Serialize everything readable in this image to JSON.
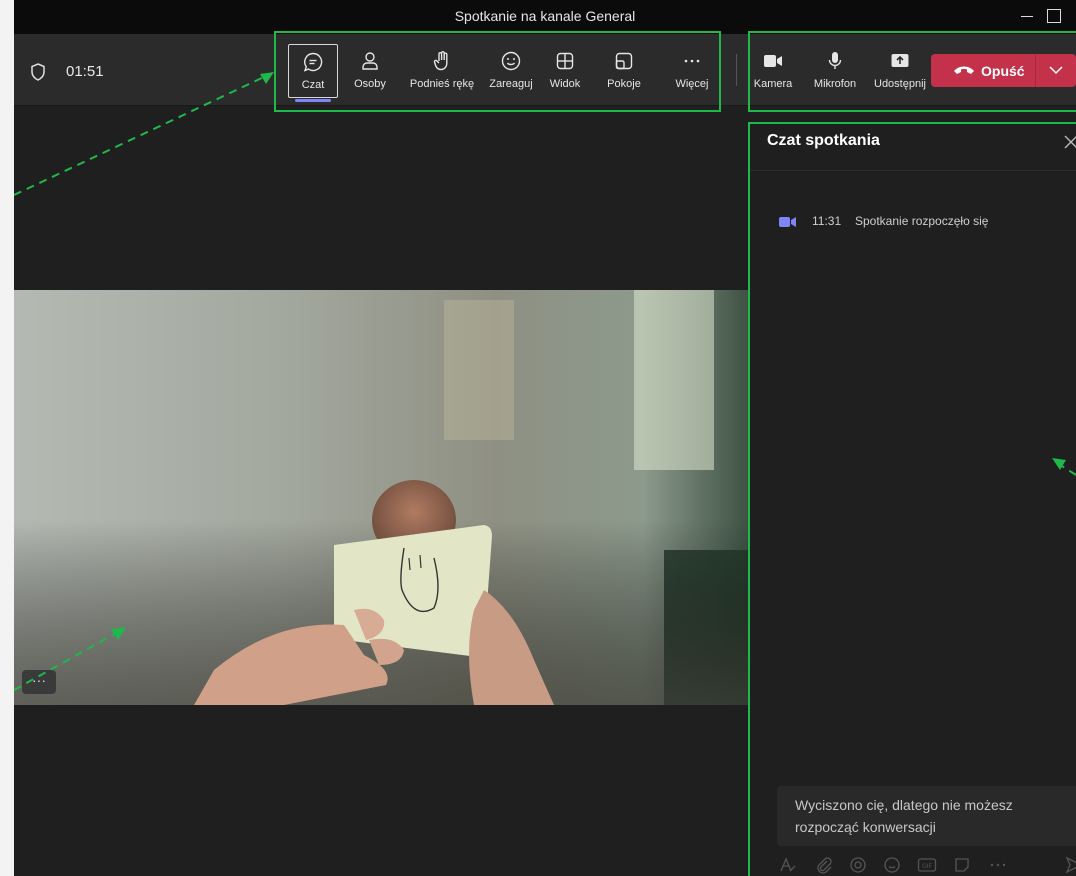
{
  "window": {
    "title": "Spotkanie na kanale General"
  },
  "meeting": {
    "timer": "01:51"
  },
  "toolbar": {
    "buttons": [
      {
        "label": "Czat",
        "icon": "chat-icon",
        "active": true
      },
      {
        "label": "Osoby",
        "icon": "people-icon"
      },
      {
        "label": "Podnieś rękę",
        "icon": "raise-hand-icon"
      },
      {
        "label": "Zareaguj",
        "icon": "smiley-icon"
      },
      {
        "label": "Widok",
        "icon": "view-grid-icon"
      },
      {
        "label": "Pokoje",
        "icon": "rooms-icon"
      },
      {
        "label": "Więcej",
        "icon": "more-icon"
      },
      {
        "label": "Kamera",
        "icon": "camera-icon"
      },
      {
        "label": "Mikrofon",
        "icon": "microphone-icon"
      },
      {
        "label": "Udostępnij",
        "icon": "share-icon"
      }
    ],
    "leave_label": "Opuść"
  },
  "video": {
    "more_label": "···"
  },
  "chat": {
    "title": "Czat spotkania",
    "event": {
      "time": "11:31",
      "text": "Spotkanie rozpoczęło się"
    },
    "muted_message": "Wyciszono cię, dlatego nie możesz rozpocząć konwersacji",
    "compose_icons": [
      "format-icon",
      "attach-icon",
      "loop-icon",
      "emoji-icon",
      "gif-icon",
      "sticker-icon",
      "more-icon",
      "send-icon"
    ]
  },
  "colors": {
    "accent": "#7f85f5",
    "leave": "#c4314b",
    "annotation": "#1fb84a"
  }
}
